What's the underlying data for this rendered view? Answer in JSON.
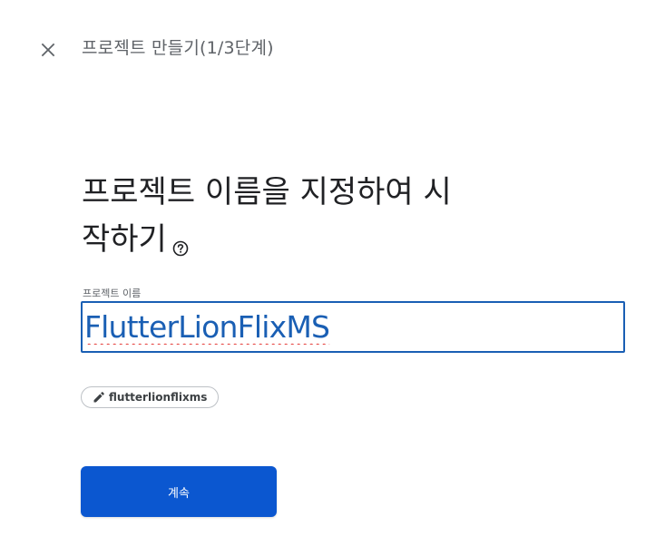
{
  "header": {
    "title": "프로젝트 만들기(1/3단계)",
    "close_icon": "close-icon"
  },
  "main": {
    "heading_line1": "프로젝트 이름을 지정하여 시",
    "heading_line2": "작하기",
    "help_icon": "help-circle-icon",
    "project_name_label": "프로젝트 이름",
    "project_name_value": "FlutterLionFlixMS",
    "project_id_chip": "flutterlionflixms",
    "edit_icon": "pencil-icon",
    "continue_label": "계속"
  },
  "colors": {
    "accent": "#0b57d0",
    "input_border": "#1a5fb4",
    "input_text": "#1a5fb4",
    "spellcheck_underline": "#e53935",
    "heading_text": "#202124",
    "muted_text": "#5f6368"
  }
}
